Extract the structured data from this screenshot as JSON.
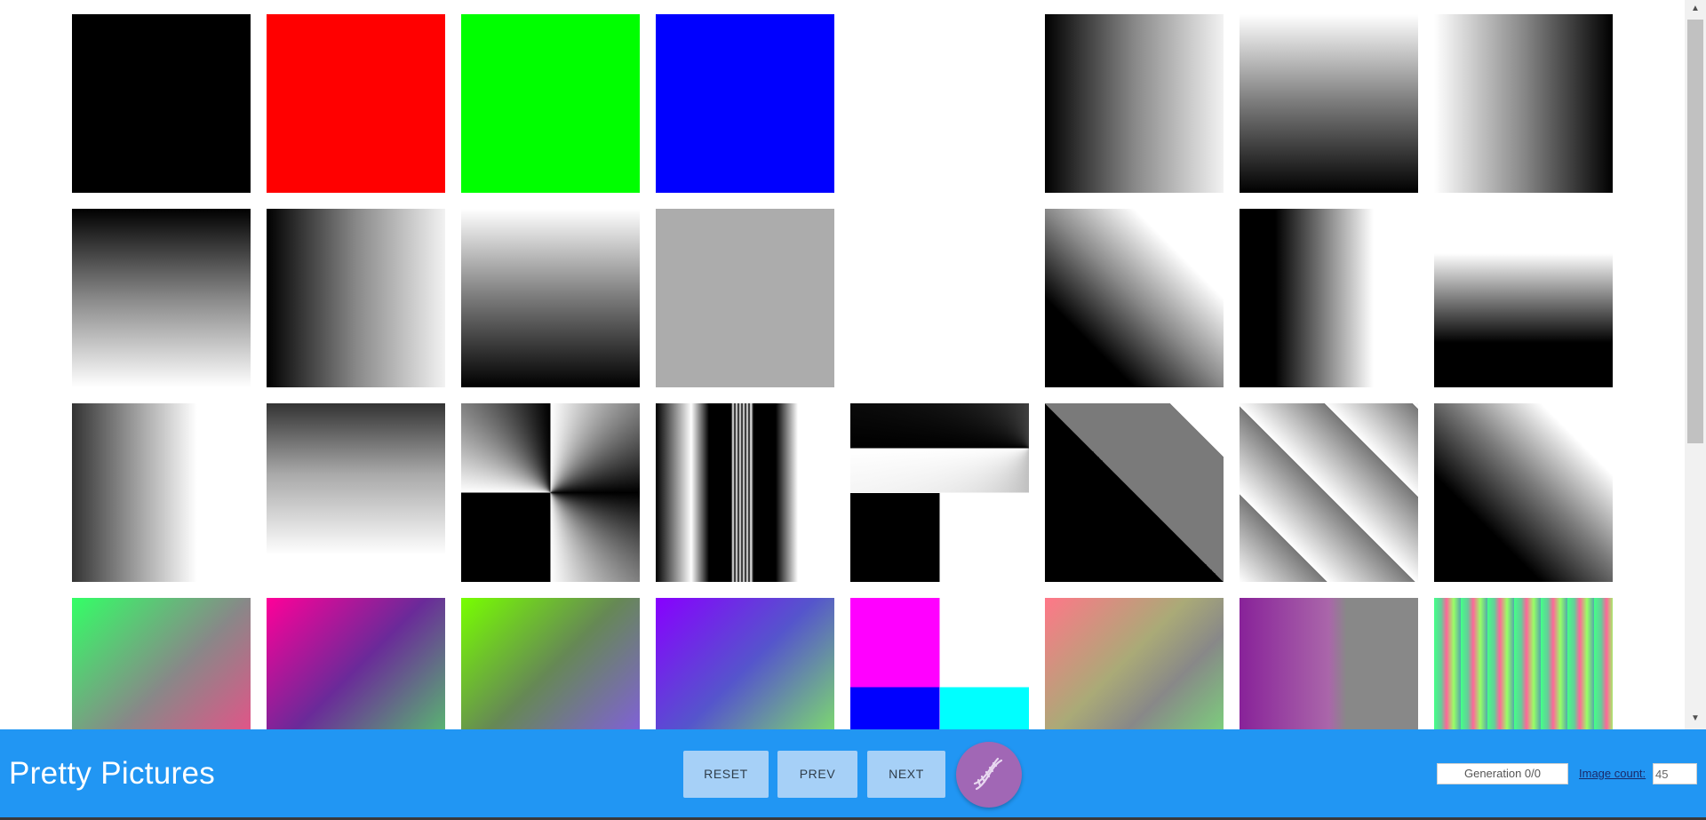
{
  "app": {
    "title": "Pretty Pictures"
  },
  "controls": {
    "reset_label": "RESET",
    "prev_label": "PREV",
    "next_label": "NEXT",
    "evolve_icon": "dna-icon",
    "generation_text": "Generation 0/0",
    "image_count_label": "Image count:",
    "image_count_value": "45"
  },
  "colors": {
    "bar": "#2196f3",
    "button": "#a6d0f7",
    "fab": "#a167b5"
  },
  "gallery": {
    "rows": [
      [
        "black",
        "red",
        "green",
        "blue",
        "blank",
        "gradient-horizontal-dark-to-light",
        "gradient-vertical-light-to-dark",
        "gradient-horizontal-light-to-dark"
      ],
      [
        "gradient-vertical-dark-to-light",
        "gradient-horizontal-dark-to-light",
        "gradient-vertical-light-to-dark",
        "solid-gray",
        "blank",
        "gradient-diagonal",
        "band-vertical-black-to-white",
        "band-horizontal-white-to-black"
      ],
      [
        "gradient-horizontal-half",
        "gradient-vertical-dark-to-white",
        "conic-bowtie",
        "vertical-stripes",
        "conic-quadrant",
        "diagonal-bands-gray",
        "diagonal-stripes",
        "gradient-diagonal-dark"
      ],
      [
        "color-gradient-green-pink",
        "color-gradient-magenta-green",
        "color-gradient-lime-violet",
        "color-gradient-purple-cyan",
        "color-blocks",
        "color-gradient-salmon-gray",
        "color-gradient-purple-gray",
        "color-plaid"
      ]
    ]
  }
}
